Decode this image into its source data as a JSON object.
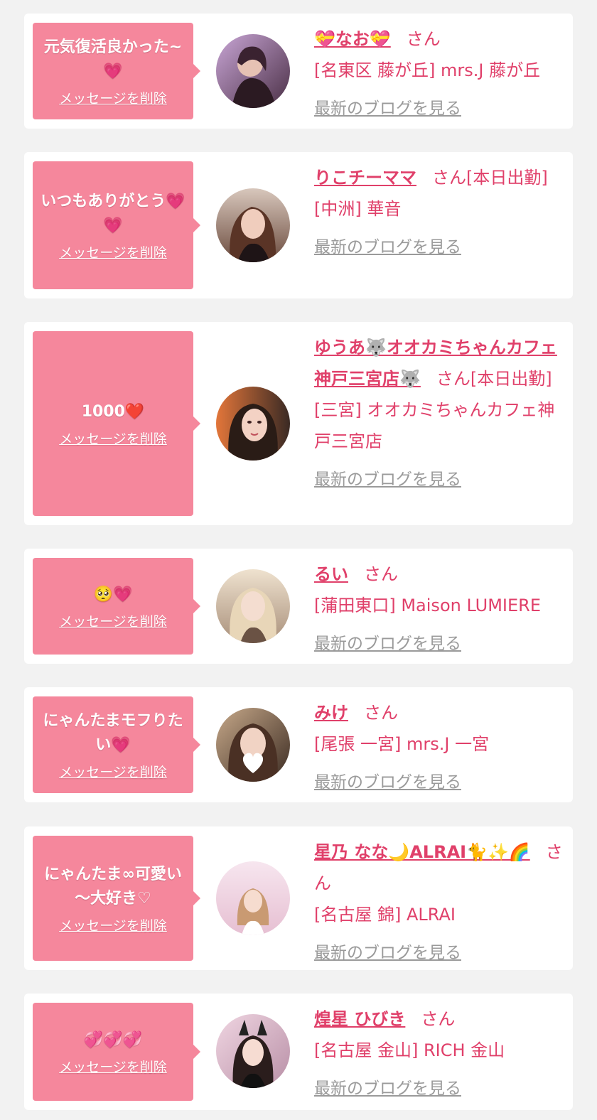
{
  "colors": {
    "page_bg": "#f2f2f2",
    "bubble": "#f5879c",
    "accent_text": "#e0406a",
    "link_gray": "#9a9a9a"
  },
  "delete_label": "メッセージを削除",
  "blog_label": "最新のブログを見る",
  "entries": [
    {
      "message": "元気復活良かった~💗",
      "name": "💝なお💝",
      "suffix": "さん",
      "shop": "[名東区 藤が丘] mrs.J 藤が丘",
      "avatar_icon": "profile-photo"
    },
    {
      "message": "いつもありがとう💗💗",
      "name": "りこチーママ",
      "suffix": "さん[本日出勤]",
      "shop": "[中洲] 華音",
      "avatar_icon": "profile-photo"
    },
    {
      "message": "1000❤️",
      "name": "ゆうあ🐺オオカミちゃんカフェ神戸三宮店🐺",
      "suffix": "さん[本日出勤]",
      "shop": "[三宮] オオカミちゃんカフェ神戸三宮店",
      "avatar_icon": "profile-photo"
    },
    {
      "message": "🥺💗",
      "name": "るい",
      "suffix": "さん",
      "shop": "[蒲田東口] Maison LUMIERE",
      "avatar_icon": "profile-photo"
    },
    {
      "message": "にゃんたまモフりたい💗",
      "name": "みけ",
      "suffix": "さん",
      "shop": "[尾張 一宮] mrs.J 一宮",
      "avatar_icon": "profile-photo"
    },
    {
      "message": "にゃんたま∞可愛い～大好き♡",
      "name": "星乃 なな🌙ALRAI🐈✨🌈",
      "suffix": "さん",
      "shop": "[名古屋 錦] ALRAI",
      "avatar_icon": "profile-photo"
    },
    {
      "message": "💞💞💞",
      "name": "煌星 ひびき",
      "suffix": "さん",
      "shop": "[名古屋 金山] RICH 金山",
      "avatar_icon": "profile-photo"
    }
  ]
}
